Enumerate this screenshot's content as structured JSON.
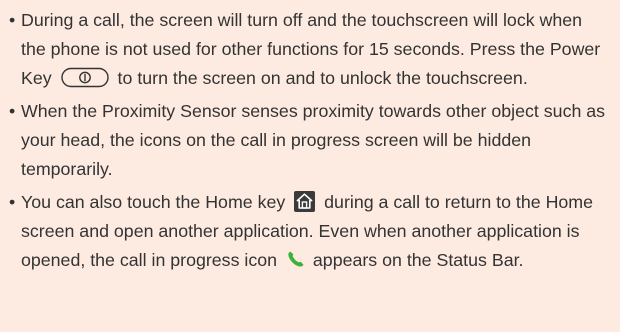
{
  "notes": [
    {
      "bullet": "•",
      "text_before_icon": "During a call, the screen will turn off and the touchscreen will lock when the phone is not used for other functions for 15 seconds. Press the Power Key",
      "icon": "power-key-icon",
      "text_after_icon": "to turn the screen on and to unlock the touchscreen."
    },
    {
      "bullet": "•",
      "text": "When the Proximity Sensor senses proximity towards other object such as your head, the icons on the call in progress screen will be hidden temporarily."
    },
    {
      "bullet": "•",
      "text_before_icon": "You can also touch the Home key",
      "icon": "home-key-icon",
      "text_middle": "during a call to return to the Home screen and open another application. Even when another application is opened, the call in progress icon",
      "icon_2": "call-in-progress-icon",
      "text_after_icon": "appears on the Status Bar."
    }
  ],
  "colors": {
    "background": "#fdebe2",
    "text": "#333333",
    "home_key": "#3a3a3a",
    "call_icon": "#3db23a"
  }
}
